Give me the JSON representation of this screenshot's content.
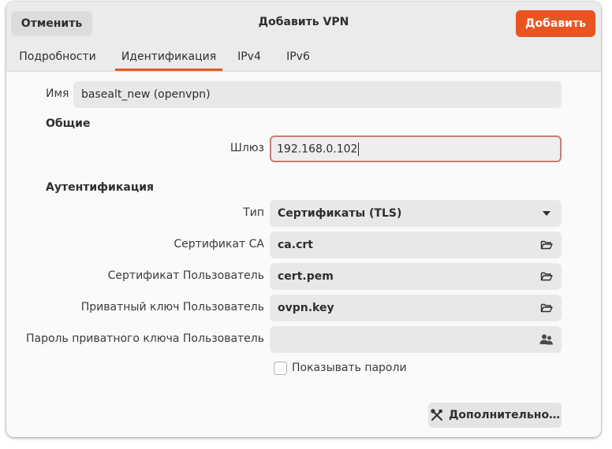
{
  "header": {
    "title": "Добавить VPN",
    "cancel_label": "Отменить",
    "add_label": "Добавить"
  },
  "tabs": [
    {
      "label": "Подробности",
      "active": false
    },
    {
      "label": "Идентификация",
      "active": true
    },
    {
      "label": "IPv4",
      "active": false
    },
    {
      "label": "IPv6",
      "active": false
    }
  ],
  "form": {
    "name_label": "Имя",
    "name_value": "basealt_new (openvpn)",
    "general_heading": "Общие",
    "gateway_label": "Шлюз",
    "gateway_value": "192.168.0.102",
    "auth_heading": "Аутентификация",
    "type_label": "Тип",
    "type_value": "Сертификаты (TLS)",
    "ca_label": "Сертификат CA",
    "ca_value": "ca.crt",
    "user_cert_label": "Сертификат Пользователь",
    "user_cert_value": "cert.pem",
    "private_key_label": "Приватный ключ Пользователь",
    "private_key_value": "ovpn.key",
    "key_password_label": "Пароль приватного ключа Пользователь",
    "key_password_value": "",
    "show_passwords_label": "Показывать пароли",
    "show_passwords_checked": false,
    "advanced_label": "Дополнительно…"
  },
  "colors": {
    "accent": "#e95420",
    "focus_border": "#c97d72"
  },
  "icons": {
    "dropdown": "pan-down-icon",
    "file_chooser": "folder-open-icon",
    "password_storage": "users-icon",
    "advanced": "tools-icon"
  }
}
